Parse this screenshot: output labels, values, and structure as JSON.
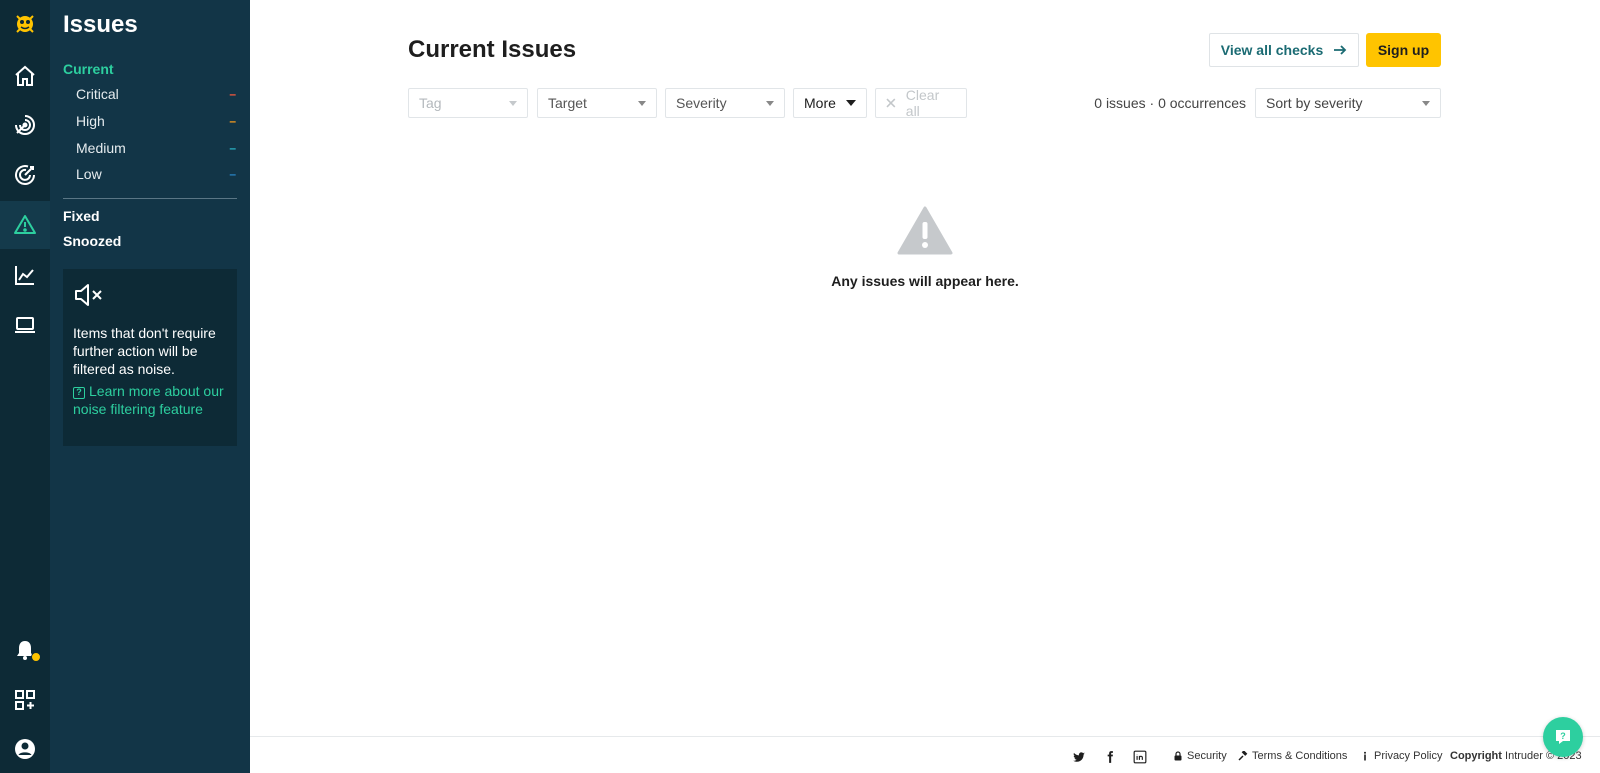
{
  "sidebar": {
    "title": "Issues",
    "current_label": "Current",
    "severities": [
      {
        "label": "Critical",
        "count": "–",
        "color": "#ff5a3c"
      },
      {
        "label": "High",
        "count": "–",
        "color": "#ff9f1c"
      },
      {
        "label": "Medium",
        "count": "–",
        "color": "#2bb6c9"
      },
      {
        "label": "Low",
        "count": "–",
        "color": "#2a86c9"
      }
    ],
    "fixed_label": "Fixed",
    "snoozed_label": "Snoozed",
    "noise": {
      "text": "Items that don't require further action will be filtered as noise.",
      "link": "Learn more about our noise filtering feature"
    }
  },
  "rail": {
    "icons": [
      "logo-icon",
      "home-icon",
      "radar-icon",
      "target-icon",
      "warning-icon",
      "chart-icon",
      "laptop-icon",
      "bell-icon",
      "apps-icon",
      "account-icon"
    ]
  },
  "header": {
    "title": "Current Issues",
    "view_all_label": "View all checks",
    "signup_label": "Sign up"
  },
  "filters": {
    "tag_placeholder": "Tag",
    "target_label": "Target",
    "severity_label": "Severity",
    "more_label": "More",
    "clear_label": "Clear all",
    "counts": "0 issues · 0 occurrences",
    "sort_label": "Sort by severity"
  },
  "empty_state": {
    "text": "Any issues will appear here."
  },
  "footer": {
    "security": "Security",
    "terms": "Terms & Conditions",
    "privacy": "Privacy Policy",
    "copyright_bold": "Copyright",
    "copyright_rest": "Intruder © 2023"
  },
  "colors": {
    "accent": "#2dcf9f",
    "brand_yellow": "#ffc400",
    "rail_bg": "#0d2a36",
    "sidebar_bg": "#123547"
  }
}
